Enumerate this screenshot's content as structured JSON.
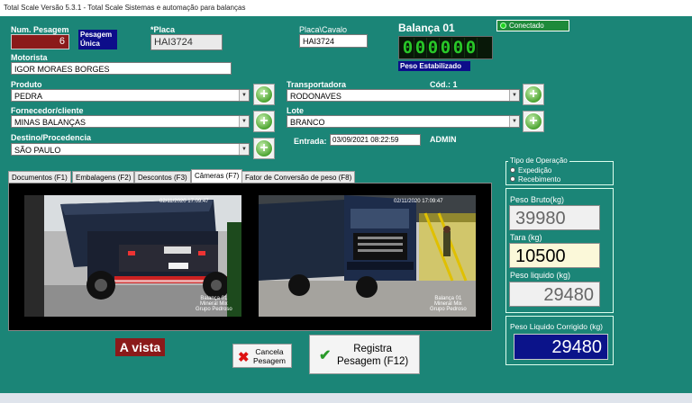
{
  "window": {
    "title": "Total Scale Versão 5.3.1  -  Total Scale Sistemas e automação para balanças"
  },
  "status": {
    "text": "Conectado",
    "color": "#1fd21f"
  },
  "pesagem": {
    "label": "Num. Pesagem",
    "value": "6",
    "unica": "Pesagem\nÚnica"
  },
  "placa": {
    "label": "*Placa",
    "value": "HAI3724"
  },
  "placa_cavalo": {
    "label": "Placa\\Cavalo",
    "value": "HAI3724"
  },
  "balanca": {
    "title": "Balança 01",
    "display": "000000",
    "status": "Peso Estabilizado"
  },
  "motorista": {
    "label": "Motorista",
    "value": "IGOR MORAES BORGES"
  },
  "produto": {
    "label": "Produto",
    "value": "PEDRA"
  },
  "transportadora": {
    "label": "Transportadora",
    "value": "RODONAVES",
    "cod_label": "Cód.: 1"
  },
  "fornecedor": {
    "label": "Fornecedor/cliente",
    "value": "MINAS BALANÇAS"
  },
  "lote": {
    "label": "Lote",
    "value": "BRANCO"
  },
  "destino": {
    "label": "Destino/Procedencia",
    "value": "SÃO PAULO"
  },
  "entrada": {
    "label": "Entrada:",
    "value": "03/09/2021 08:22:59",
    "user": "ADMIN"
  },
  "tabs": [
    {
      "label": "Documentos (F1)"
    },
    {
      "label": "Embalagens (F2)"
    },
    {
      "label": "Descontos (F3)"
    },
    {
      "label": "Câmeras (F7)"
    },
    {
      "label": "Fator de Conversão de peso (F8)"
    }
  ],
  "cameras": {
    "cam1": {
      "timestamp": "02/11/2020 17:09:47",
      "overlay": "Balança 01\nMineral Mix\nGrupo Pedroso"
    },
    "cam2": {
      "timestamp": "02/11/2020 17:09:47",
      "overlay": "Balança 01\nMineral Mix\nGrupo Pedroso"
    }
  },
  "operacao": {
    "title": "Tipo de Operação",
    "options": [
      "Expedição",
      "Recebimento"
    ]
  },
  "pesos": {
    "bruto_label": "Peso Bruto(kg)",
    "bruto": "39980",
    "tara_label": "Tara (kg)",
    "tara": "10500",
    "liquido_label": "Peso liquido (kg)",
    "liquido": "29480",
    "corrigido_label": "Peso Liquido Corrigido (kg)",
    "corrigido": "29480"
  },
  "pagamento": {
    "label": "A vista"
  },
  "buttons": {
    "cancela": "Cancela\nPesagem",
    "registra": "Registra\nPesagem (F12)"
  }
}
